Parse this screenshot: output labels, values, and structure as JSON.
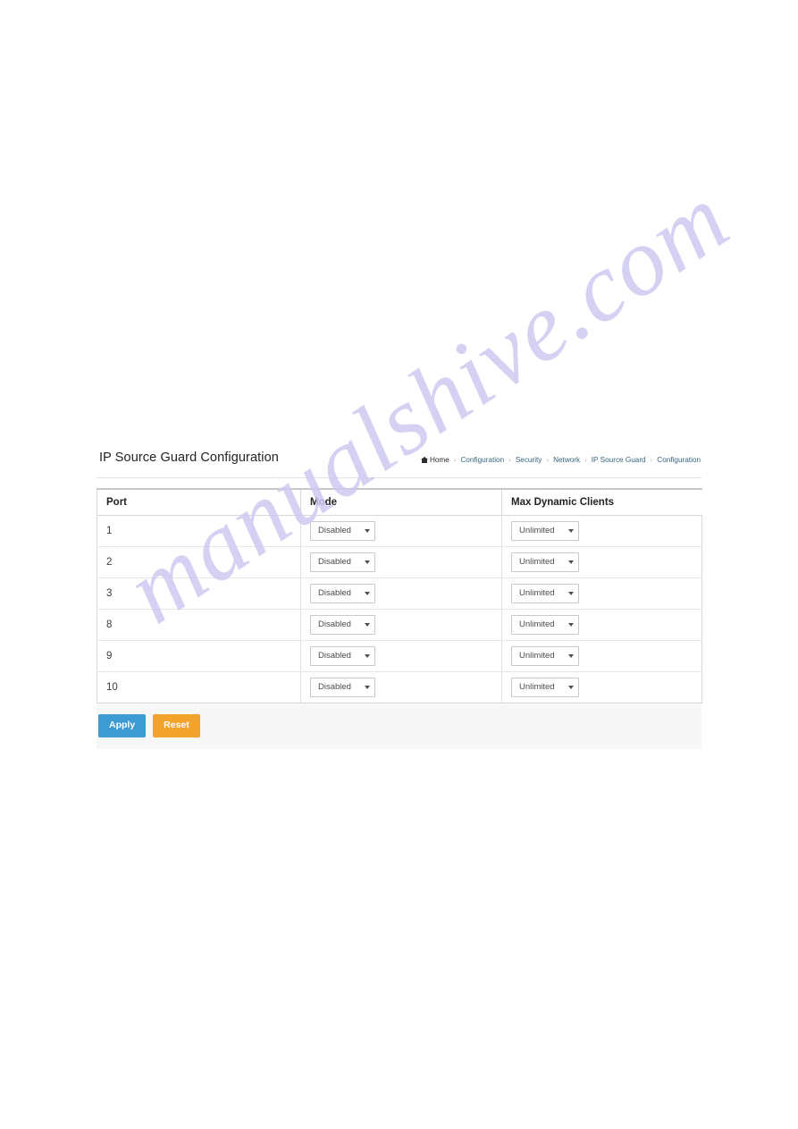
{
  "page": {
    "watermark": "manualshive.com",
    "watermark_color": "#cdc9f2",
    "background": "#ffffff"
  },
  "screen": {
    "title": "IP Source Guard Configuration",
    "breadcrumb": {
      "home_label": "Home",
      "items": [
        "Configuration",
        "Security",
        "Network",
        "IP Source Guard",
        "Configuration"
      ],
      "separator": "»"
    },
    "table": {
      "columns": [
        "Port",
        "Mode",
        "Max Dynamic Clients"
      ],
      "rows": [
        {
          "port": "1",
          "mode": "Disabled",
          "max_dynamic_clients": "Unlimited"
        },
        {
          "port": "2",
          "mode": "Disabled",
          "max_dynamic_clients": "Unlimited"
        },
        {
          "port": "3",
          "mode": "Disabled",
          "max_dynamic_clients": "Unlimited"
        },
        {
          "port": "8",
          "mode": "Disabled",
          "max_dynamic_clients": "Unlimited"
        },
        {
          "port": "9",
          "mode": "Disabled",
          "max_dynamic_clients": "Unlimited"
        },
        {
          "port": "10",
          "mode": "Disabled",
          "max_dynamic_clients": "Unlimited"
        }
      ]
    },
    "buttons": {
      "apply_label": "Apply",
      "apply_color": "#3d9bd4",
      "reset_label": "Reset",
      "reset_color": "#f2a32b"
    },
    "icons": {
      "home": "home-icon",
      "caret": "chevron-down-icon"
    }
  }
}
